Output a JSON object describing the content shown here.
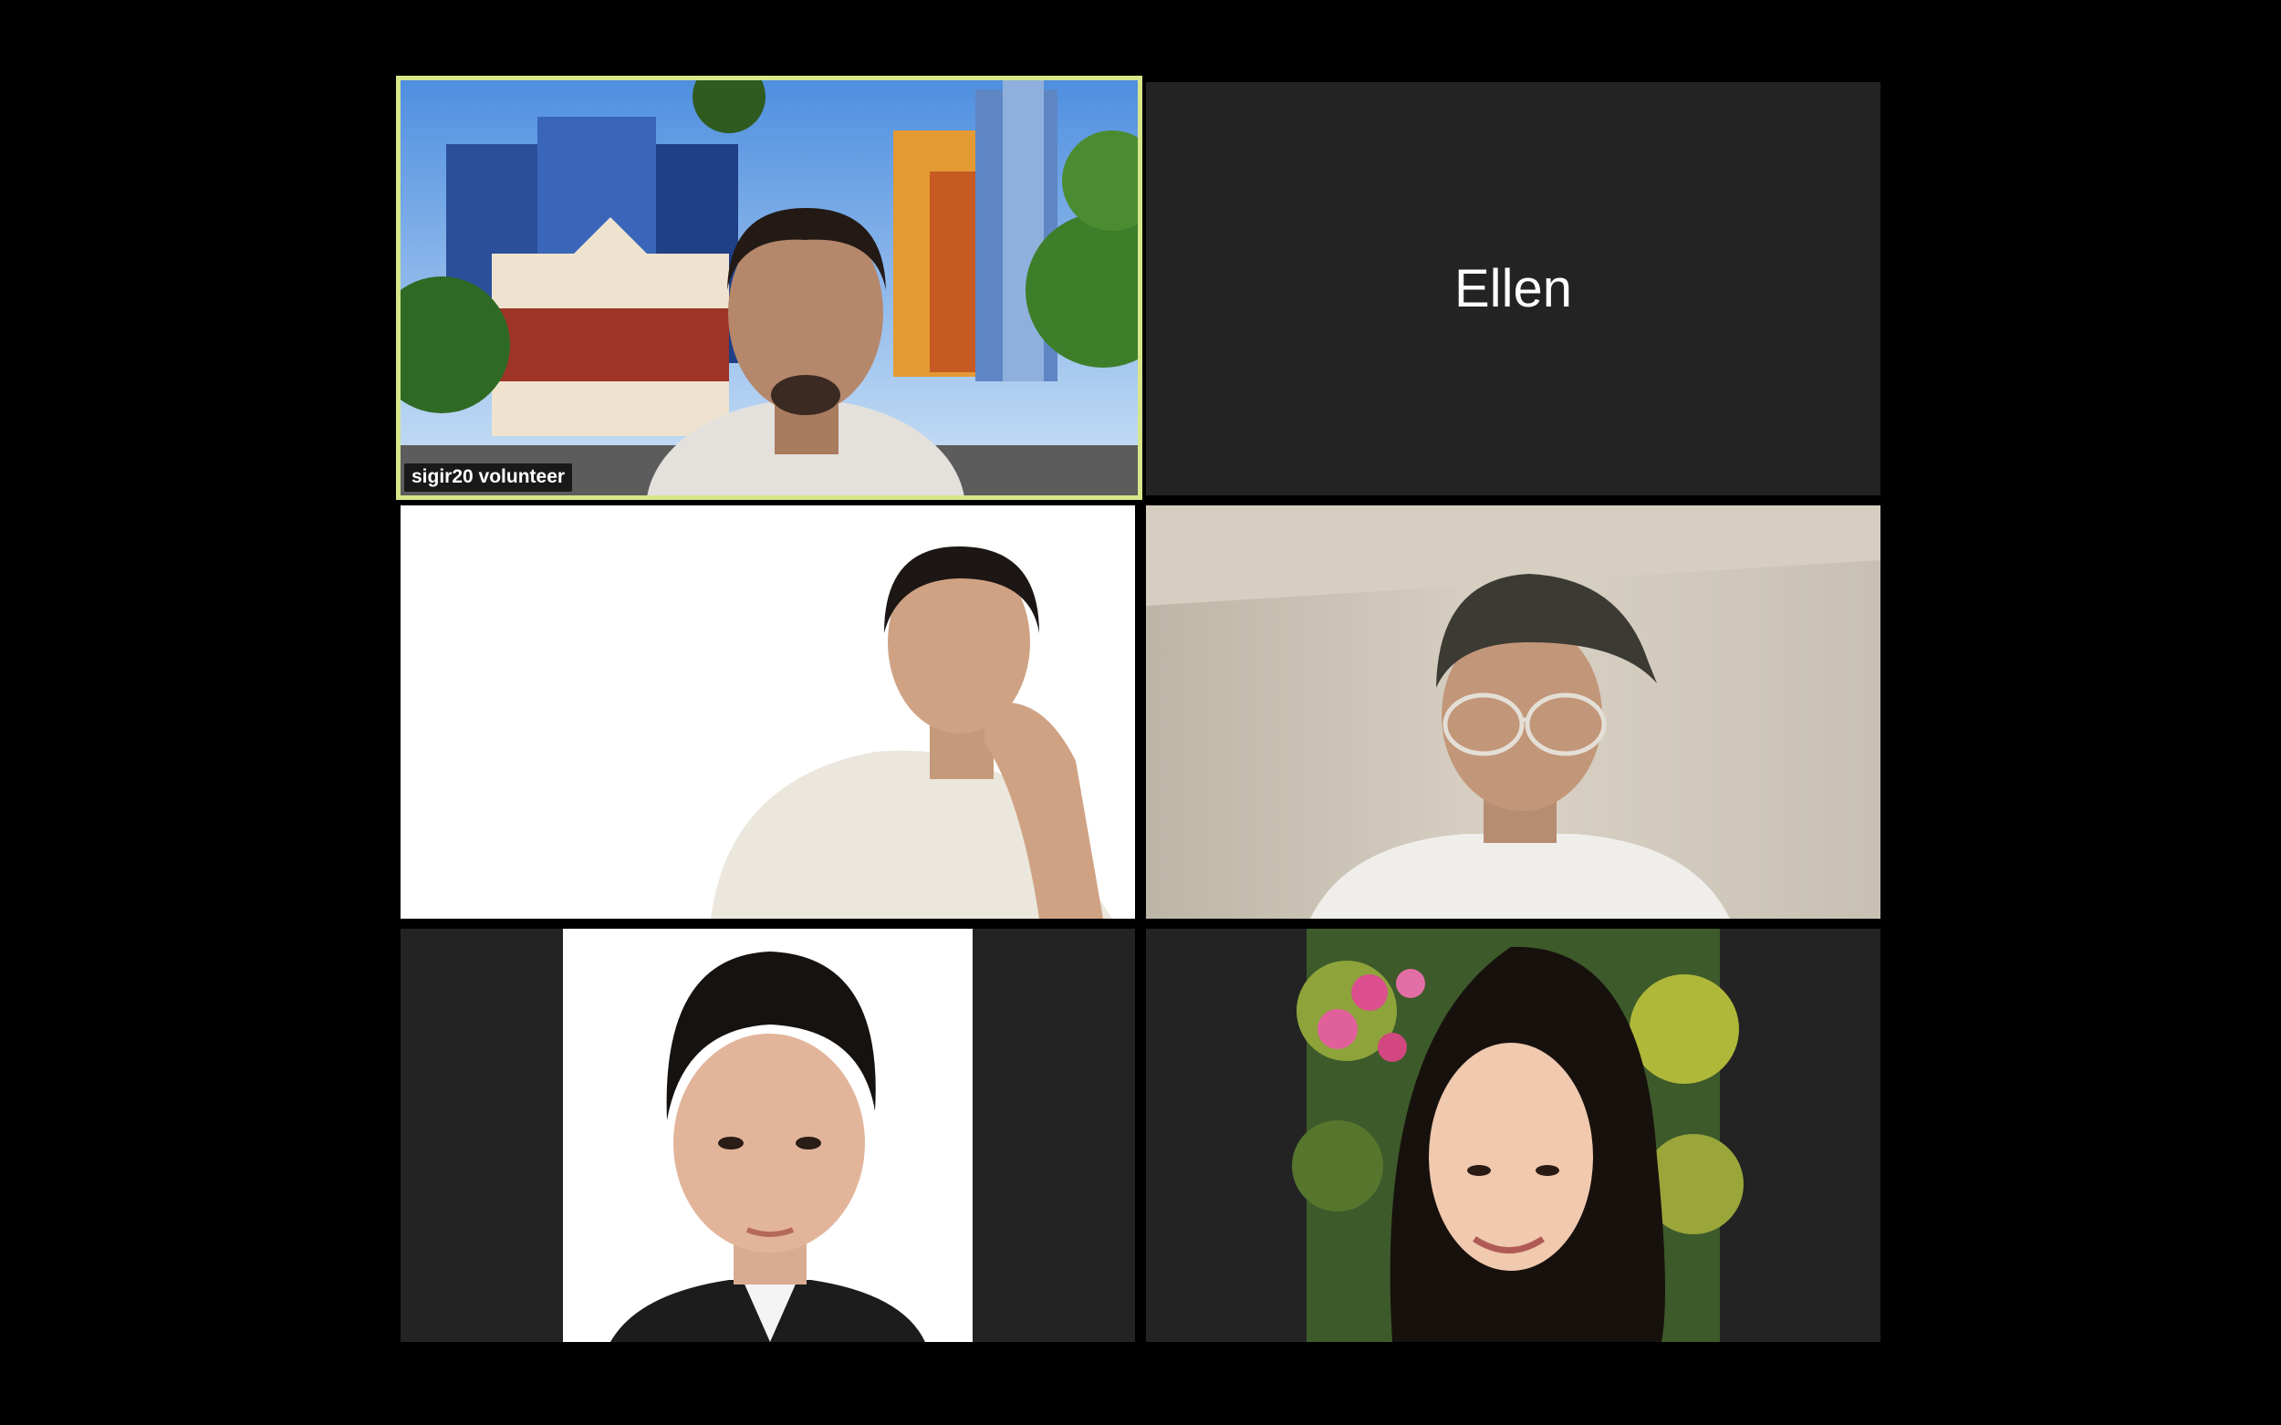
{
  "meeting": {
    "tiles": [
      {
        "id": "tile-1",
        "name_label": "sigir20 volunteer",
        "video": "on",
        "active_speaker": true
      },
      {
        "id": "tile-2",
        "name_label": "Ellen",
        "video": "off"
      },
      {
        "id": "tile-3",
        "video": "on"
      },
      {
        "id": "tile-4",
        "video": "on"
      },
      {
        "id": "tile-5",
        "video": "photo"
      },
      {
        "id": "tile-6",
        "video": "photo"
      }
    ]
  },
  "colors": {
    "background": "#000000",
    "tile_background": "#232323",
    "active_speaker_border": "#d8e68a",
    "name_text": "#ffffff"
  }
}
